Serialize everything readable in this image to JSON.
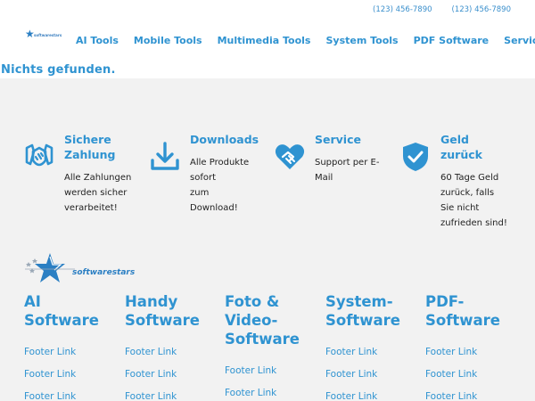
{
  "header": {
    "phones": [
      "(123) 456-7890",
      "(123) 456-7890"
    ],
    "logo_text": "softwarestars",
    "nav": [
      "AI Tools",
      "Mobile Tools",
      "Multimedia Tools",
      "System Tools",
      "PDF Software",
      "Service"
    ]
  },
  "main": {
    "message": "Nichts gefunden."
  },
  "features": [
    {
      "icon": "handshake-shield-icon",
      "title_lines": [
        "Sichere",
        "Zahlung"
      ],
      "desc_lines": [
        "Alle Zahlungen",
        "werden sicher",
        "verarbeitet!"
      ]
    },
    {
      "icon": "download-icon",
      "title_lines": [
        "Downloads"
      ],
      "desc_lines": [
        "Alle Produkte",
        "sofort",
        "zum",
        "Download!"
      ]
    },
    {
      "icon": "heart-handshake-icon",
      "title_lines": [
        "Service"
      ],
      "desc_lines": [
        "Support per E-",
        "Mail"
      ]
    },
    {
      "icon": "shield-check-icon",
      "title_lines": [
        "Geld",
        "zurück"
      ],
      "desc_lines": [
        "60 Tage Geld",
        "zurück, falls",
        "Sie nicht",
        "zufrieden sind!"
      ]
    }
  ],
  "footer": {
    "logo_text": "softwarestars",
    "columns": [
      {
        "title_lines": [
          "AI",
          "Software"
        ],
        "links": [
          "Footer Link",
          "Footer Link",
          "Footer Link"
        ]
      },
      {
        "title_lines": [
          "Handy",
          "Software"
        ],
        "links": [
          "Footer Link",
          "Footer Link",
          "Footer Link"
        ]
      },
      {
        "title_lines": [
          "Foto &",
          "Video-",
          "Software"
        ],
        "links": [
          "Footer Link",
          "Footer Link"
        ]
      },
      {
        "title_lines": [
          "System-",
          "Software"
        ],
        "links": [
          "Footer Link",
          "Footer Link",
          "Footer Link"
        ]
      },
      {
        "title_lines": [
          "PDF-",
          "Software"
        ],
        "links": [
          "Footer Link",
          "Footer Link",
          "Footer Link"
        ]
      }
    ]
  },
  "colors": {
    "accent": "#2f93d1",
    "background": "#f2f2f2"
  }
}
